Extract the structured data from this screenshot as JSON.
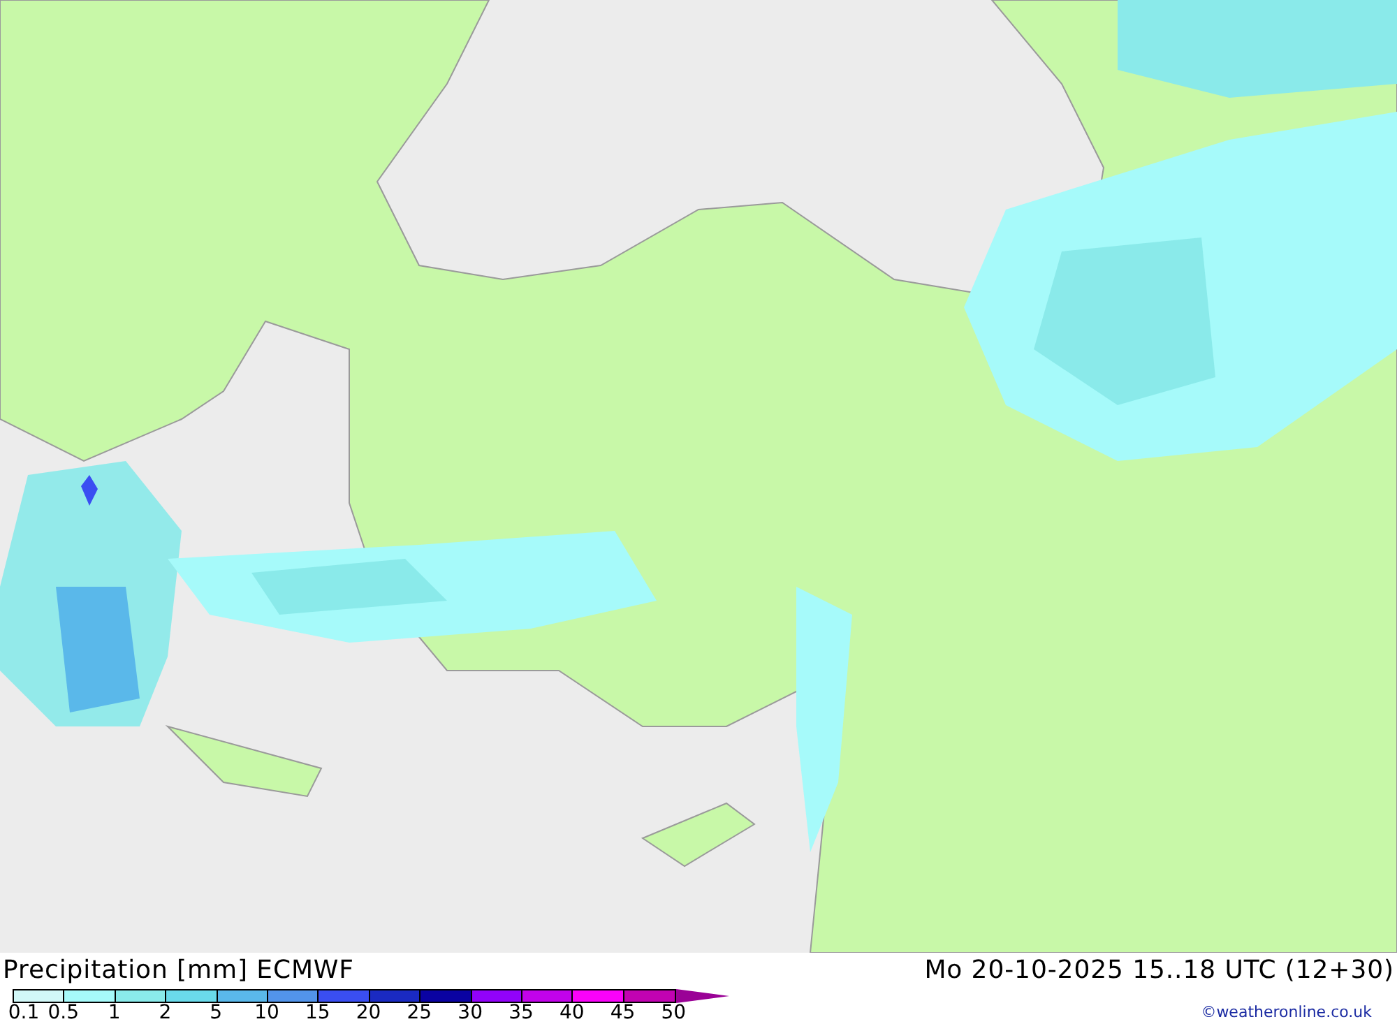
{
  "map": {
    "kind": "precipitation-map"
  },
  "footer": {
    "title": "Precipitation [mm] ECMWF",
    "datetime": "Mo 20-10-2025 15..18 UTC (12+30)",
    "credit": "©weatheronline.co.uk",
    "legend": [
      {
        "color": "#d2f8f8"
      },
      {
        "color": "#a6fafa"
      },
      {
        "color": "#8aeaea"
      },
      {
        "color": "#6adaea"
      },
      {
        "color": "#5ab8ea"
      },
      {
        "color": "#5294ea"
      },
      {
        "color": "#3a4ef2"
      },
      {
        "color": "#1a2ac2"
      },
      {
        "color": "#0a02a2"
      },
      {
        "color": "#9202fa"
      },
      {
        "color": "#c202ea"
      },
      {
        "color": "#fa02fa"
      },
      {
        "color": "#c202b2"
      },
      {
        "color": "#9a0296",
        "kind": "arrow"
      }
    ],
    "ticks": [
      "0.1",
      "0.5",
      "1",
      "2",
      "5",
      "10",
      "15",
      "20",
      "25",
      "30",
      "35",
      "40",
      "45",
      "50"
    ]
  }
}
